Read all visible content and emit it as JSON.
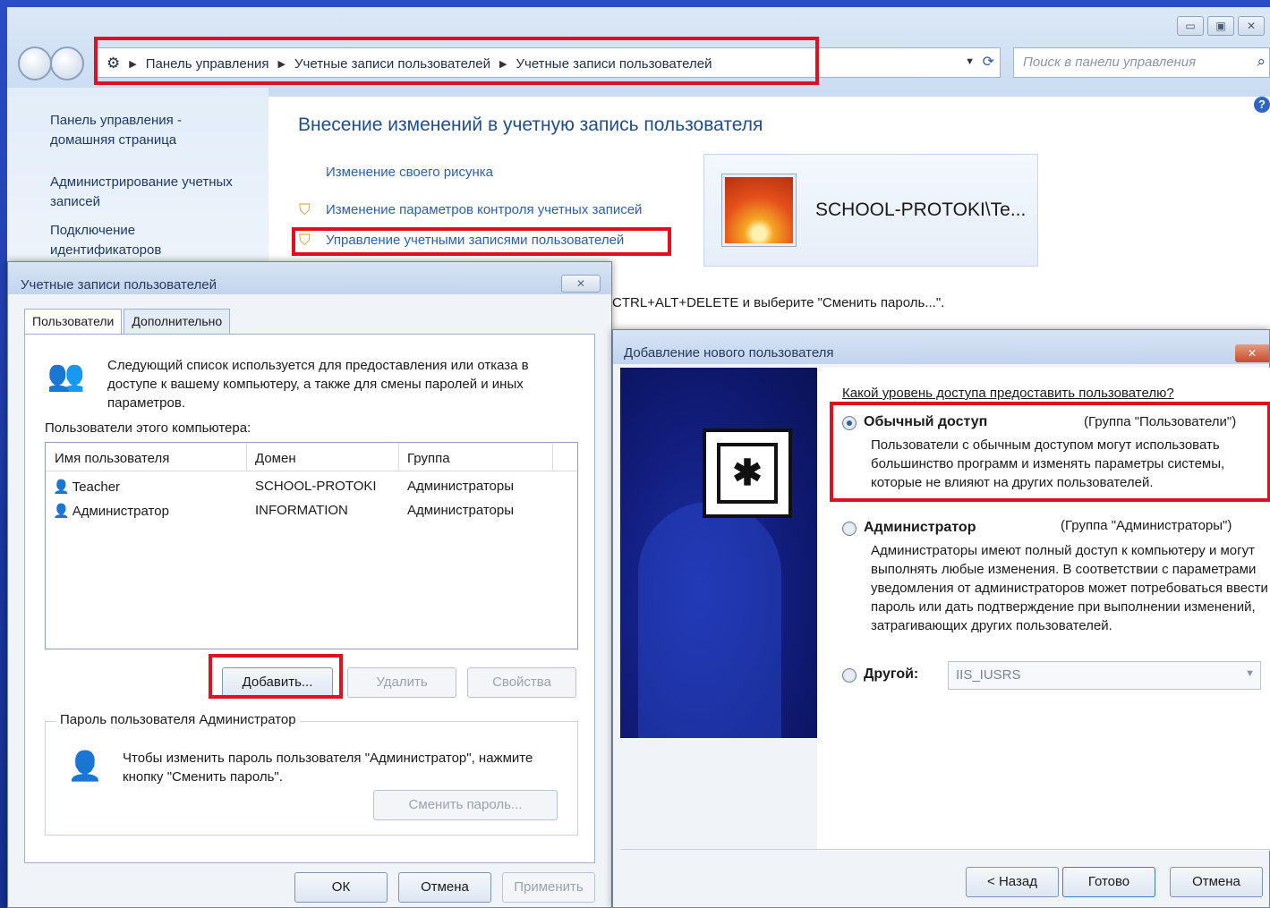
{
  "window": {
    "min_label": "▭",
    "max_label": "▣",
    "close_label": "✕"
  },
  "address": {
    "crumbs": [
      "Панель управления",
      "Учетные записи пользователей",
      "Учетные записи пользователей"
    ],
    "search_placeholder": "Поиск в панели управления"
  },
  "sidebar": {
    "items": [
      "Панель управления - домашняя страница",
      "Администрирование учетных записей",
      "Подключение идентификаторов пользователей Интернета"
    ]
  },
  "main": {
    "title": "Внесение изменений в учетную запись пользователя",
    "tasks": [
      "Изменение своего рисунка",
      "Изменение параметров контроля учетных записей",
      "Управление учетными записями пользователей"
    ],
    "user_name": "SCHOOL-PROTOKI\\Te...",
    "hint": "CTRL+ALT+DELETE и выберите \"Сменить пароль...\"."
  },
  "user_accounts_dialog": {
    "title": "Учетные записи пользователей",
    "close_label": "✕",
    "tabs": [
      "Пользователи",
      "Дополнительно"
    ],
    "description": "Следующий список используется для предоставления или отказа в доступе к вашему компьютеру, а также для смены паролей и иных параметров.",
    "users_label": "Пользователи этого компьютера:",
    "columns": [
      "Имя пользователя",
      "Домен",
      "Группа"
    ],
    "rows": [
      {
        "name": "Teacher",
        "domain": "SCHOOL-PROTOKI",
        "group": "Администраторы"
      },
      {
        "name": "Администратор",
        "domain": "INFORMATION",
        "group": "Администраторы"
      }
    ],
    "add_label": "Добавить...",
    "remove_label": "Удалить",
    "props_label": "Свойства",
    "password_group_title": "Пароль пользователя Администратор",
    "password_text": "Чтобы изменить пароль пользователя \"Администратор\", нажмите кнопку \"Сменить пароль\".",
    "change_password_label": "Сменить пароль...",
    "ok_label": "ОК",
    "cancel_label": "Отмена",
    "apply_label": "Применить"
  },
  "add_user_wizard": {
    "title": "Добавление нового пользователя",
    "close_label": "✕",
    "question": "Какой уровень доступа предоставить пользователю?",
    "options": [
      {
        "label": "Обычный доступ",
        "group": "(Группа \"Пользователи\")",
        "desc": "Пользователи с обычным доступом могут использовать большинство программ и изменять параметры системы, которые не влияют на других пользователей.",
        "checked": true
      },
      {
        "label": "Администратор",
        "group": "(Группа \"Администраторы\")",
        "desc": "Администраторы имеют полный доступ к компьютеру и могут выполнять любые изменения. В соответствии с параметрами уведомления от администраторов может потребоваться ввести пароль или дать подтверждение при выполнении изменений, затрагивающих других пользователей.",
        "checked": false
      }
    ],
    "other_label": "Другой:",
    "other_value": "IIS_IUSRS",
    "back_label": "< Назад",
    "finish_label": "Готово",
    "cancel_label": "Отмена"
  },
  "colors": {
    "highlight": "#e01020",
    "link": "#2a5fb0",
    "title": "#1e4e8c"
  }
}
